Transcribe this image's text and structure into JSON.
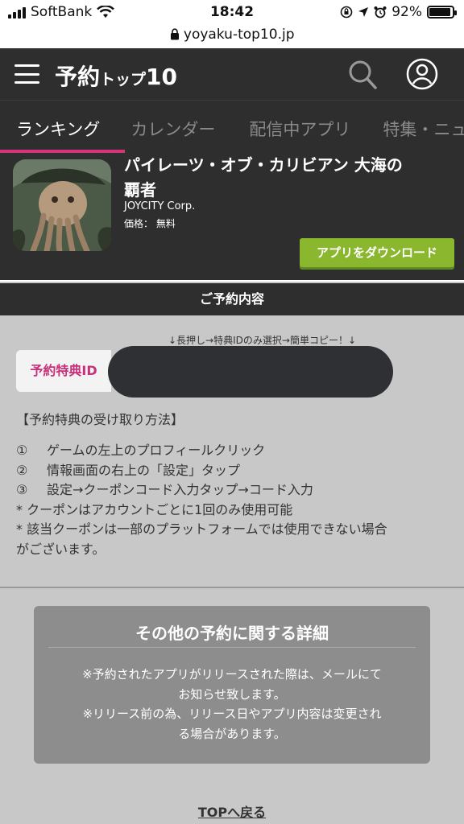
{
  "status_bar": {
    "carrier": "SoftBank",
    "time": "18:42",
    "battery": "92%",
    "battery_level": 0.92,
    "icons": [
      "signal-icon",
      "wifi-icon",
      "rotation-lock-icon",
      "location-icon",
      "alarm-icon",
      "battery-icon"
    ]
  },
  "browser": {
    "url": "yoyaku-top10.jp",
    "url_icon": "lock-icon"
  },
  "header": {
    "logo_main": "予約",
    "logo_small": "トップ",
    "logo_num": "10",
    "icons": [
      "menu-icon",
      "search-icon",
      "user-icon"
    ]
  },
  "tabs": [
    {
      "label": "ランキング",
      "active": true
    },
    {
      "label": "カレンダー",
      "active": false
    },
    {
      "label": "配信中アプリ",
      "active": false
    },
    {
      "label": "特集・ニュ",
      "active": false
    }
  ],
  "colors": {
    "dark_bg": "#2e2e2e",
    "accent_pink": "#d6337a",
    "download_green": "#8ab72e",
    "page_bg": "#c8c8c8",
    "card_gray": "#8d8d8d"
  },
  "app": {
    "title_line1": "パイレーツ・オブ・カリビアン 大海の",
    "title_line2": "覇者",
    "developer": "JOYCITY Corp.",
    "price": "価格： 無料",
    "download_label": "アプリをダウンロード"
  },
  "reservation": {
    "section_title": "ご予約内容",
    "hint": "↓長押し→特典IDのみ選択→簡単コピー！↓",
    "id_label": "予約特典ID",
    "method_title": "【予約特典の受け取り方法】",
    "steps": [
      {
        "num": "①",
        "text": "ゲームの左上のプロフィールクリック"
      },
      {
        "num": "②",
        "text": "情報画面の右上の「設定」タップ"
      },
      {
        "num": "③",
        "text": "設定→クーポンコード入力タップ→コード入力"
      }
    ],
    "notes": [
      "* クーポンはアカウントごとに1回のみ使用可能",
      "* 該当クーポンは一部のプラットフォームでは使用できない場合",
      "がございます。"
    ]
  },
  "details": {
    "title": "その他の予約に関する詳細",
    "lines": [
      "※予約されたアプリがリリースされた際は、メールにて",
      "お知らせ致します。",
      "※リリース前の為、リリース日やアプリ内容は変更され",
      "る場合があります。"
    ]
  },
  "footer": {
    "back_label": "TOPへ戻る"
  }
}
